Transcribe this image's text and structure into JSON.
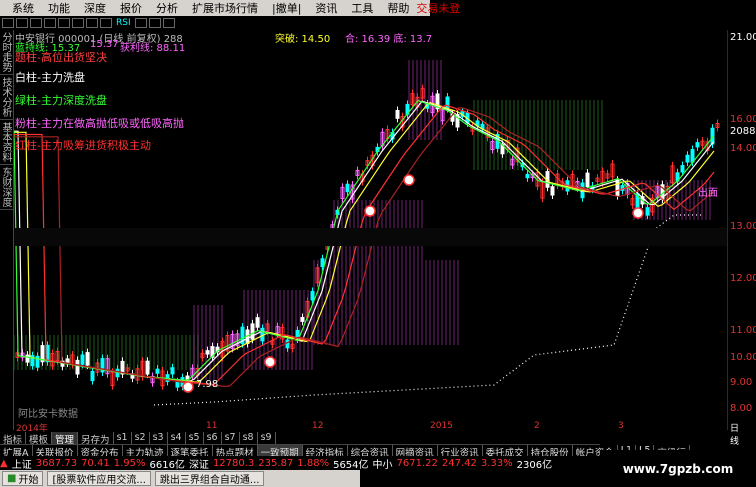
{
  "menu": {
    "items": [
      "系统",
      "功能",
      "深度",
      "报价",
      "分析",
      "扩展市场行情",
      "|撤单|",
      "资讯",
      "工具",
      "帮助"
    ],
    "right_label": "交易未登"
  },
  "toolbar": {
    "rsi_label": "RSI"
  },
  "left_tabs": [
    "分时走势",
    "技术分析",
    "基本资料",
    "东财深度"
  ],
  "stock_info": {
    "line1": "中安银行 000001 (日线 前复权) 288",
    "line2_a": "蓝持线: 15.37",
    "line2_b": "15.37",
    "line2_c": "获利线: 88.11",
    "top_right_a": "突破: 14.50",
    "top_right_b": "合: 16.39 底: 13.7"
  },
  "legend": [
    {
      "text": "题柱-高位出货坚决",
      "color": "#ff4040"
    },
    {
      "text": "白柱-主力洗盘",
      "color": "#ffffff"
    },
    {
      "text": "绿柱-主力深度洗盘",
      "color": "#33ff33"
    },
    {
      "text": "粉柱-主力在做高抛低吸或低吸高抛",
      "color": "#ff66ff"
    },
    {
      "text": "红柱-主力吸筹进货积极主动",
      "color": "#ff3030"
    }
  ],
  "chart_labels": {
    "sell_tag": "出面",
    "low_tag": "7.98",
    "bottom_text": "阿比安卡数据"
  },
  "y_axis": {
    "labels": [
      "16.00",
      "20884",
      "14.00",
      "13.00",
      "12.00",
      "11.00",
      "10.00",
      "9.00",
      "8.00"
    ],
    "top_value": "21.00"
  },
  "x_axis": {
    "labels": [
      "2014年",
      "11",
      "12",
      "2015",
      "2",
      "3"
    ],
    "period": "日线"
  },
  "bottom_tabs": [
    "指标",
    "模板",
    "管理",
    "另存为",
    "s1",
    "s2",
    "s3",
    "s4",
    "s5",
    "s6",
    "s7",
    "s8",
    "s9"
  ],
  "bottom_tabs_active": 2,
  "func_tabs": [
    "扩展A",
    "关联报价",
    "资金分布",
    "主力轨迹",
    "逐笔委托",
    "热点题材",
    "一致预期",
    "经济指标",
    "综合资讯",
    "网摘资讯",
    "行业资讯",
    "委托成交",
    "持仓股份",
    "帐户资金",
    "L1",
    "L5",
    "高级行"
  ],
  "func_selected": 6,
  "quotes": {
    "sh_label": "上证",
    "sh_value": "3687.73",
    "sh_change": "70.41",
    "sh_pct": "1.95%",
    "sh_amount": "6616亿",
    "sz_label": "深证",
    "sz_value": "12780.3",
    "sz_change": "235.87",
    "sz_pct": "1.88%",
    "sz_amount": "5654亿",
    "zx_label": "中小",
    "zx_value": "7671.22",
    "zx_change": "247.42",
    "zx_pct": "3.33%",
    "zx_amount": "2306亿"
  },
  "taskbar": {
    "start_label": "开始",
    "items": [
      "[股票软件应用交流...",
      "跳出三界组合自动通..."
    ]
  },
  "watermark": "www.7gpzb.com",
  "colors": {
    "up": "#ff3030",
    "down": "#00ffff",
    "axis": "#8b0000",
    "ma_yellow": "#ffff33",
    "ma_green": "#33ff33",
    "ma_white": "#ffffff",
    "ma_pink": "#ff66ff",
    "dots": "#ffffff"
  }
}
